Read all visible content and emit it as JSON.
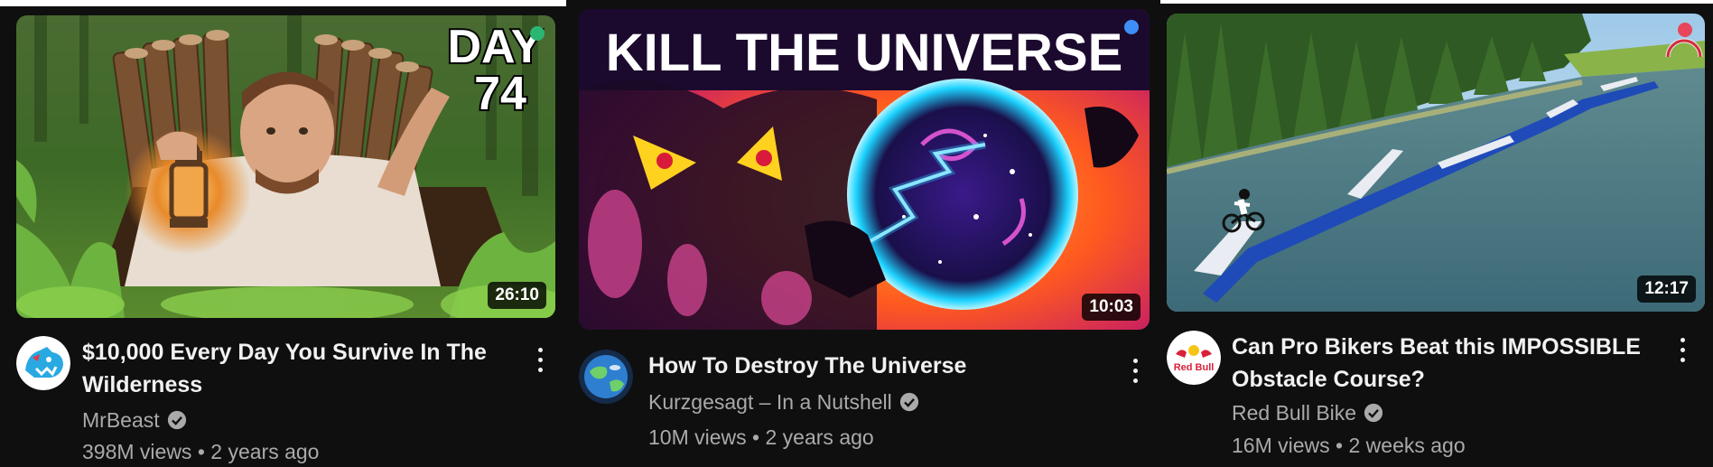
{
  "videos": [
    {
      "thumbnail": {
        "overlay_text": "DAY 74",
        "overlay_line1": "DAY",
        "overlay_line2": "74",
        "duration": "26:10",
        "indicator_color": "#2bb673"
      },
      "title": "$10,000 Every Day You Survive In The Wilderness",
      "title_line1": "$10,000 Every Day You Survive In The",
      "title_line2": "Wilderness",
      "channel": "MrBeast",
      "verified": true,
      "views": "398M views",
      "age": "2 years ago",
      "avatar_icon": "mrbeast-panther-logo-icon"
    },
    {
      "thumbnail": {
        "overlay_text": "KILL THE UNIVERSE",
        "duration": "10:03",
        "indicator_color": "#3e8ef7"
      },
      "title": "How To Destroy The Universe",
      "channel": "Kurzgesagt – In a Nutshell",
      "verified": true,
      "views": "10M views",
      "age": "2 years ago",
      "avatar_icon": "kurzgesagt-planet-logo-icon"
    },
    {
      "thumbnail": {
        "overlay_text": "",
        "duration": "12:17",
        "indicator_color": "#e8475b"
      },
      "title": "Can Pro Bikers Beat this IMPOSSIBLE Obstacle Course?",
      "title_line1": "Can Pro Bikers Beat this IMPOSSIBLE",
      "title_line2": "Obstacle Course?",
      "channel": "Red Bull Bike",
      "verified": true,
      "views": "16M views",
      "age": "2 weeks ago",
      "avatar_icon": "red-bull-logo-icon",
      "avatar_text": "Red Bull"
    }
  ],
  "separator": " • ",
  "colors": {
    "background": "#0f0f0f",
    "title_text": "#f1f1f1",
    "secondary_text": "#aaaaaa"
  }
}
